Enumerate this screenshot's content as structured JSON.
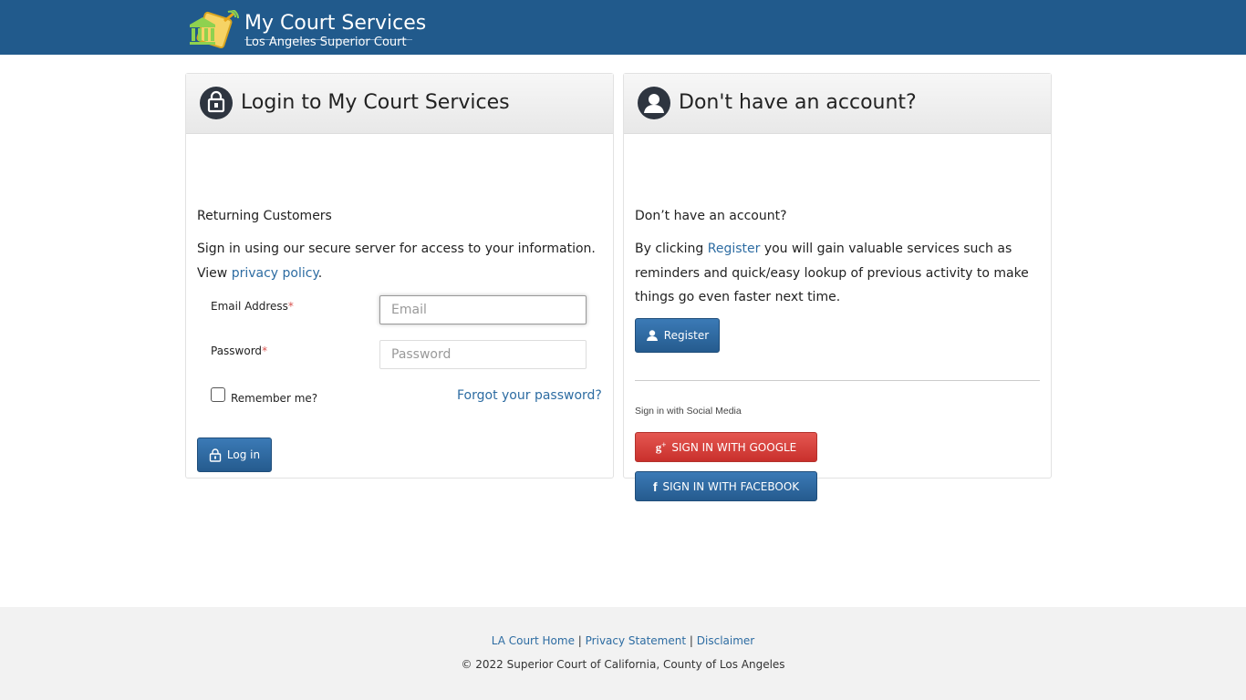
{
  "header": {
    "title": "My Court Services",
    "subtitle": "Los Angeles Superior Court"
  },
  "login": {
    "heading": "Login to My Court Services",
    "returning": "Returning Customers",
    "intro": "Sign in using our secure server for access to your information. View",
    "privacy_link": "privacy policy",
    "email_label": "Email Address",
    "email_placeholder": "Email",
    "password_label": "Password",
    "password_placeholder": "Password",
    "required_mark": "*",
    "remember": "Remember me?",
    "forgot": "Forgot your password?",
    "login_button": "Log in"
  },
  "register": {
    "heading": "Don't have an account?",
    "question": "Don’t have an account?",
    "text_before": "By clicking",
    "register_link": "Register",
    "text_after": "you will gain valuable services such as reminders and quick/easy lookup of previous activity to make things go even faster next time.",
    "register_button": "Register",
    "social_label": "Sign in with Social Media",
    "google_button": "SIGN IN WITH GOOGLE",
    "facebook_button": "SIGN IN WITH FACEBOOK"
  },
  "footer": {
    "links": [
      "LA Court Home",
      "Privacy Statement",
      "Disclaimer"
    ],
    "separator": "|",
    "copyright": "© 2022 Superior Court of California, County of Los Angeles"
  },
  "colors": {
    "header_bg": "#215a8c",
    "link": "#2d6ca2",
    "primary_button": "#2d6ca2",
    "google_button": "#d9413b",
    "required": "#d9534f"
  }
}
